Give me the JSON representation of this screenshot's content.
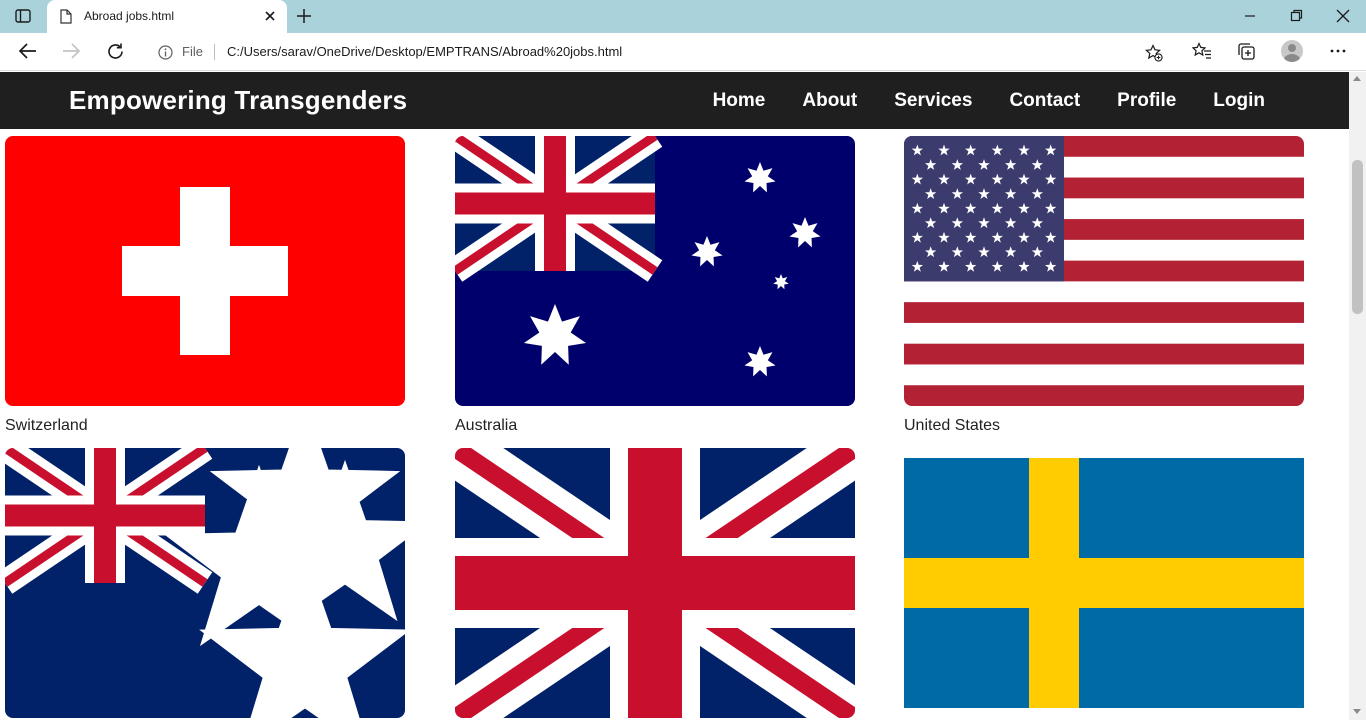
{
  "browser": {
    "tab_title": "Abroad jobs.html",
    "file_label": "File",
    "url": "C:/Users/sarav/OneDrive/Desktop/EMPTRANS/Abroad%20jobs.html"
  },
  "site": {
    "brand": "Empowering Transgenders",
    "nav": [
      "Home",
      "About",
      "Services",
      "Contact",
      "Profile",
      "Login"
    ]
  },
  "countries": [
    {
      "name": "Switzerland",
      "flag_icon": "switzerland-flag-icon"
    },
    {
      "name": "Australia",
      "flag_icon": "australia-flag-icon"
    },
    {
      "name": "United States",
      "flag_icon": "united-states-flag-icon"
    },
    {
      "name": "",
      "flag_icon": "new-zealand-flag-icon"
    },
    {
      "name": "",
      "flag_icon": "united-kingdom-flag-icon"
    },
    {
      "name": "",
      "flag_icon": "sweden-flag-icon"
    }
  ],
  "colors": {
    "tabbar": "#a9d2da",
    "header_bg": "#1f1f1f",
    "swiss_red": "#ff0000",
    "navy": "#00247d",
    "us_red": "#b22234",
    "us_blue": "#3c3b6e",
    "sweden_blue": "#006aa7",
    "sweden_yellow": "#fecc00"
  }
}
